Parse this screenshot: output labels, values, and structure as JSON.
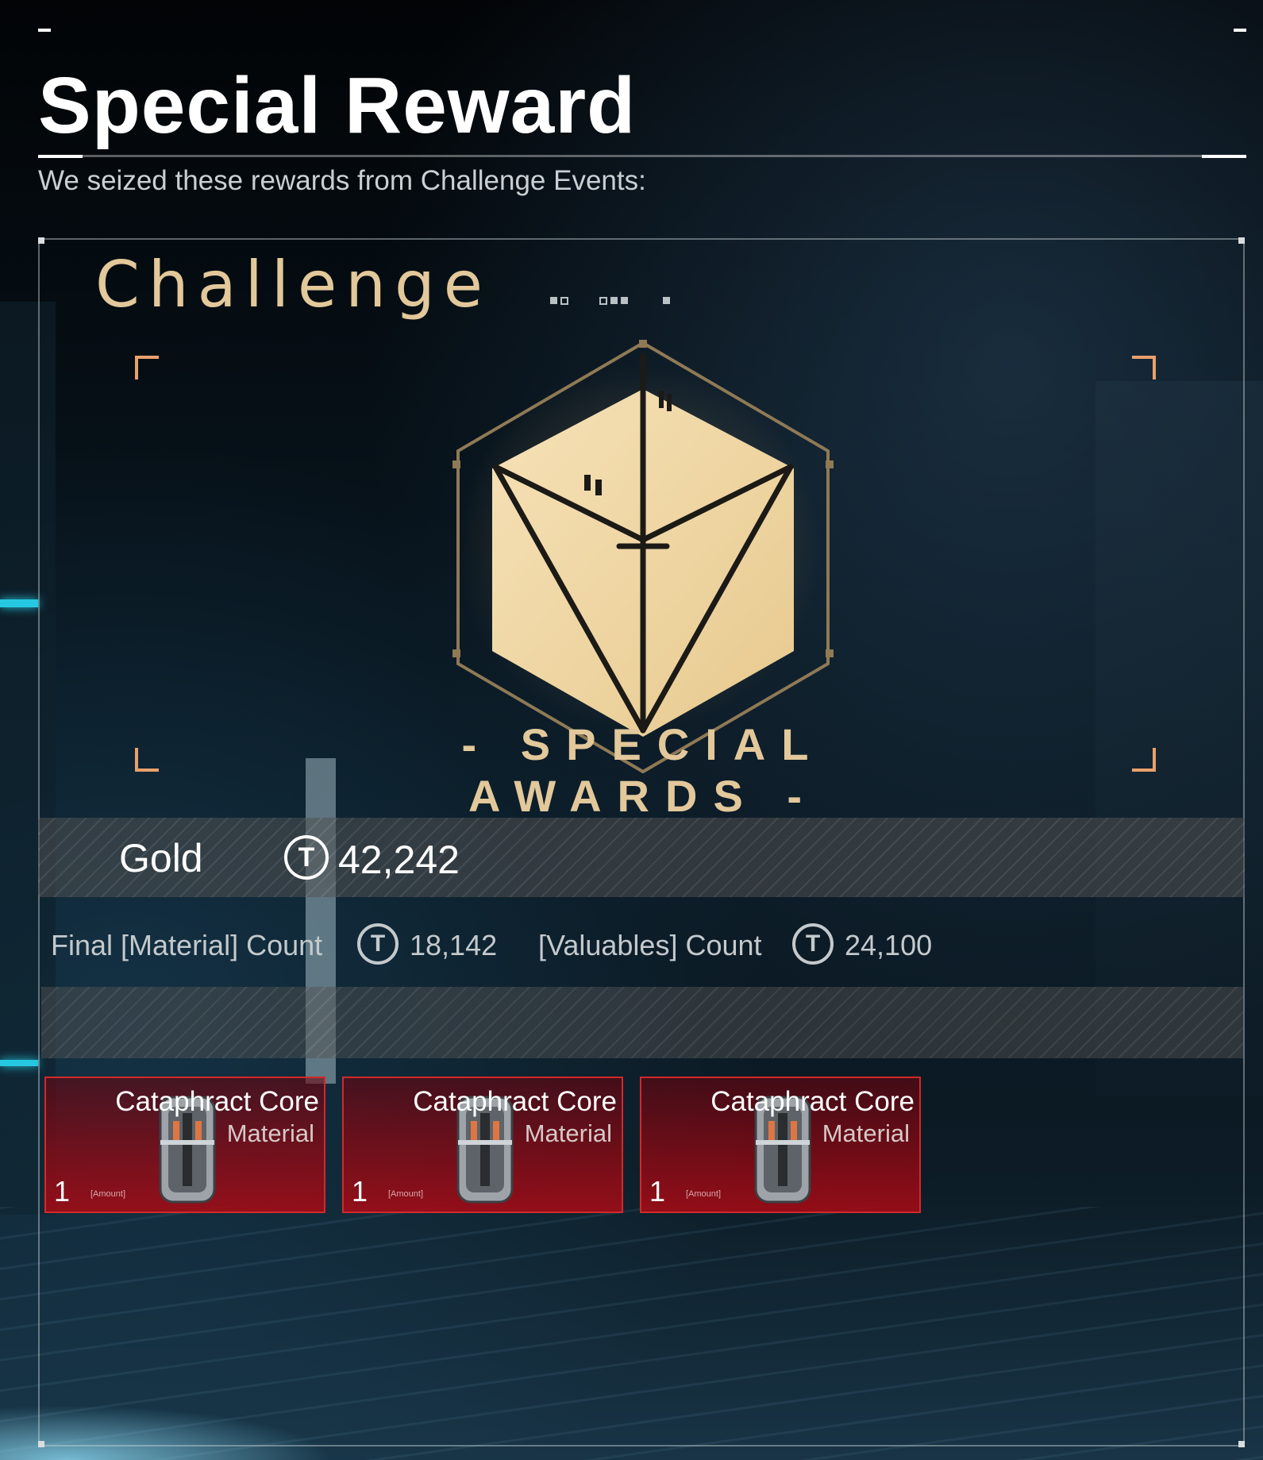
{
  "header": {
    "title": "Special Reward",
    "subtitle": "We seized these rewards from Challenge Events:"
  },
  "panel": {
    "category_title": "Challenge",
    "emblem_caption": "- SPECIAL AWARDS -",
    "accent_color": "#e2c89a"
  },
  "gold": {
    "label": "Gold",
    "coin_glyph": "T",
    "value": "42,242"
  },
  "counts": [
    {
      "label": "Final [Material] Count",
      "coin_glyph": "T",
      "value": "18,142"
    },
    {
      "label": "[Valuables] Count",
      "coin_glyph": "T",
      "value": "24,100"
    }
  ],
  "rewards": [
    {
      "name": "Cataphract Core",
      "type": "Material",
      "quantity": "1",
      "amount_label": "[Amount]",
      "icon": "cataphract-core-icon"
    },
    {
      "name": "Cataphract Core",
      "type": "Material",
      "quantity": "1",
      "amount_label": "[Amount]",
      "icon": "cataphract-core-icon"
    },
    {
      "name": "Cataphract Core",
      "type": "Material",
      "quantity": "1",
      "amount_label": "[Amount]",
      "icon": "cataphract-core-icon"
    }
  ],
  "colors": {
    "card_border": "#d02a2a",
    "bracket": "#e9a06b"
  }
}
